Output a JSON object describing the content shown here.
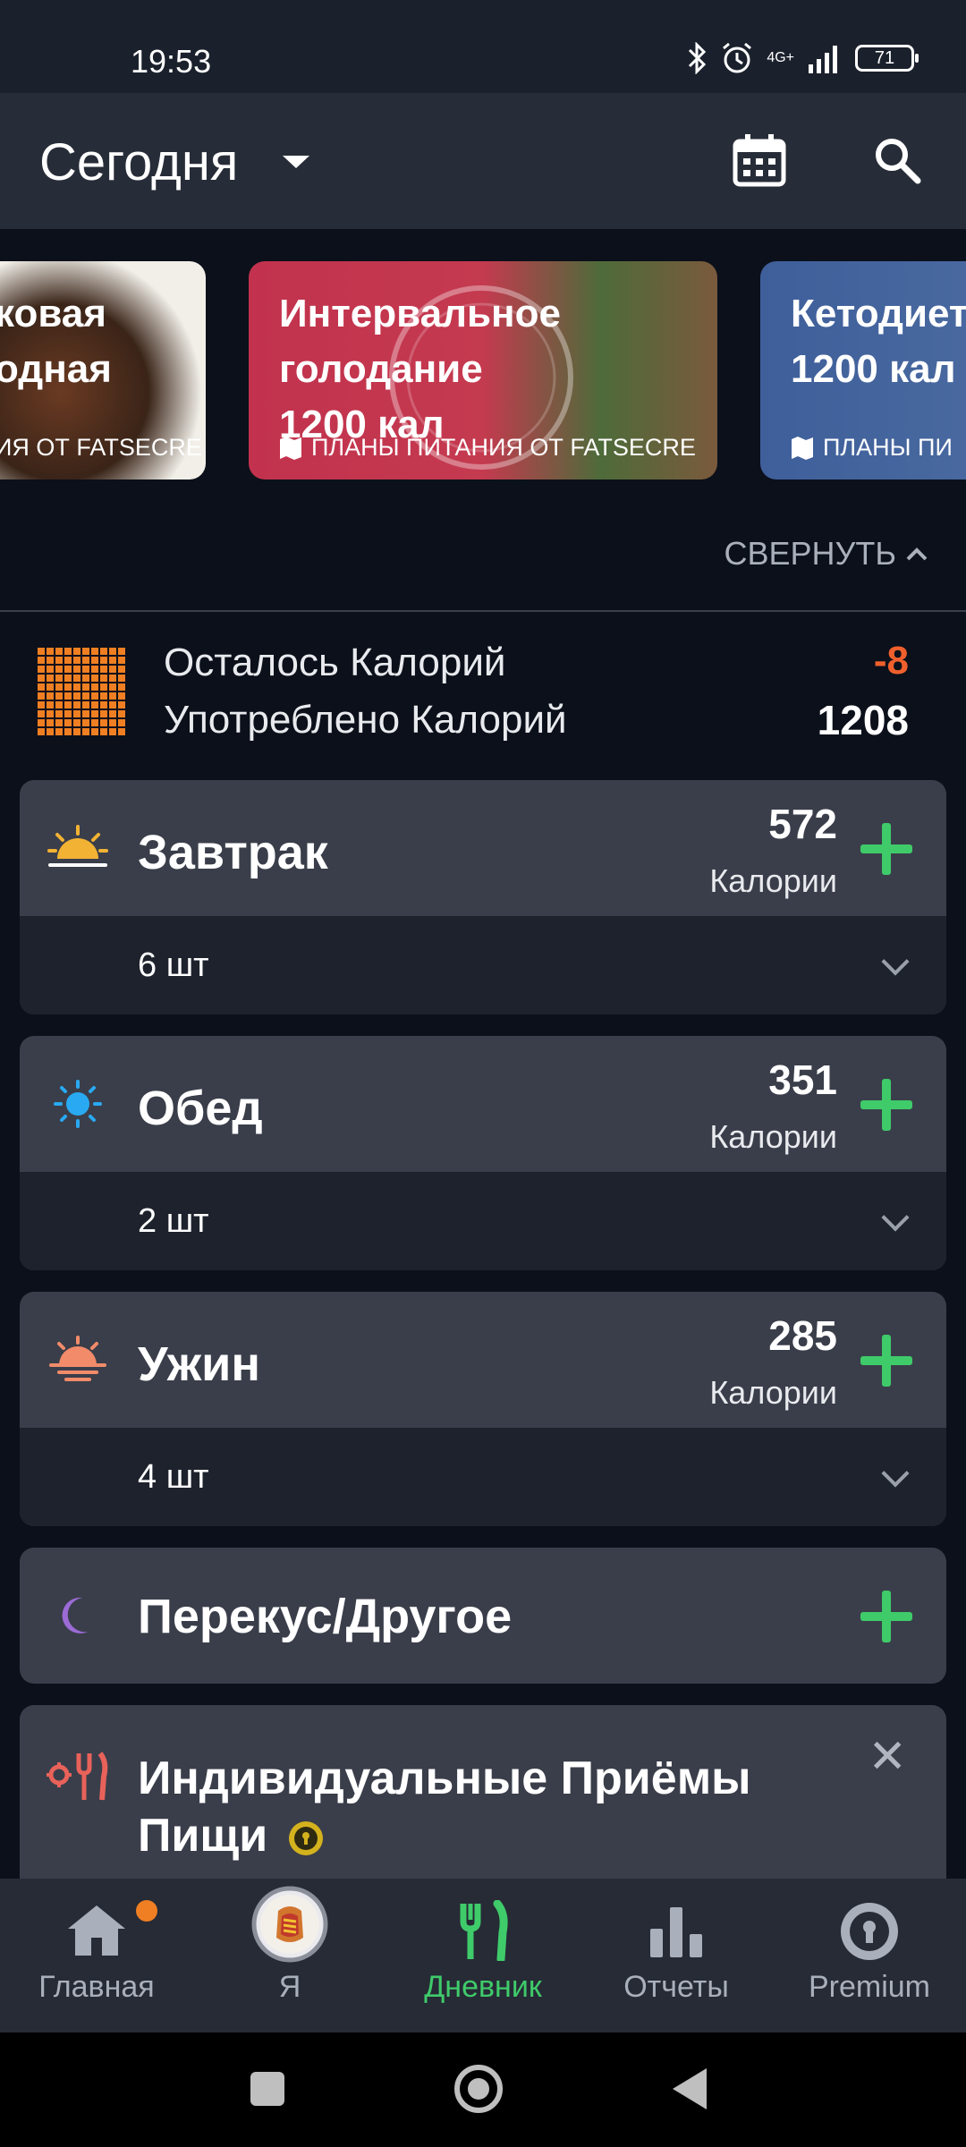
{
  "status_bar": {
    "time": "19:53",
    "network": "4G+",
    "battery": "71"
  },
  "app_bar": {
    "title": "Сегодня"
  },
  "plans": [
    {
      "title_line1": "ковая",
      "title_line2": "одная",
      "subtitle": "ИЯ ОТ FATSECRE"
    },
    {
      "title_line1": "Интервальное",
      "title_line2": "голодание",
      "title_line3": "1200 кал",
      "subtitle": "ПЛАНЫ ПИТАНИЯ ОТ FATSECRE"
    },
    {
      "title_line1": "Кетодиет",
      "title_line2": "1200 кал",
      "subtitle": "ПЛАНЫ ПИ"
    }
  ],
  "collapse_label": "СВЕРНУТЬ",
  "summary": {
    "remaining_label": "Осталось Калорий",
    "remaining_value": "-8",
    "consumed_label": "Употреблено Калорий",
    "consumed_value": "1208"
  },
  "meals": [
    {
      "name": "Завтрак",
      "calories": "572",
      "unit": "Калории",
      "count": "6 шт",
      "icon": "sunrise-icon"
    },
    {
      "name": "Обед",
      "calories": "351",
      "unit": "Калории",
      "count": "2 шт",
      "icon": "sun-icon"
    },
    {
      "name": "Ужин",
      "calories": "285",
      "unit": "Калории",
      "count": "4 шт",
      "icon": "sunset-icon"
    }
  ],
  "snack": {
    "name": "Перекус/Другое",
    "icon": "moon-icon"
  },
  "custom_meals": {
    "name": "Индивидуальные Приёмы Пищи"
  },
  "bottom_nav": [
    {
      "label": "Главная",
      "icon": "home-icon"
    },
    {
      "label": "Я",
      "icon": "avatar"
    },
    {
      "label": "Дневник",
      "icon": "fork-knife-icon",
      "active": true
    },
    {
      "label": "Отчеты",
      "icon": "bar-chart-icon"
    },
    {
      "label": "Premium",
      "icon": "premium-badge-icon"
    }
  ],
  "colors": {
    "accent_green": "#3fcb6a",
    "accent_orange": "#ef7f22",
    "negative_red": "#f0602c",
    "card_red": "#c2324e",
    "card_blue": "#3f5f9b"
  }
}
